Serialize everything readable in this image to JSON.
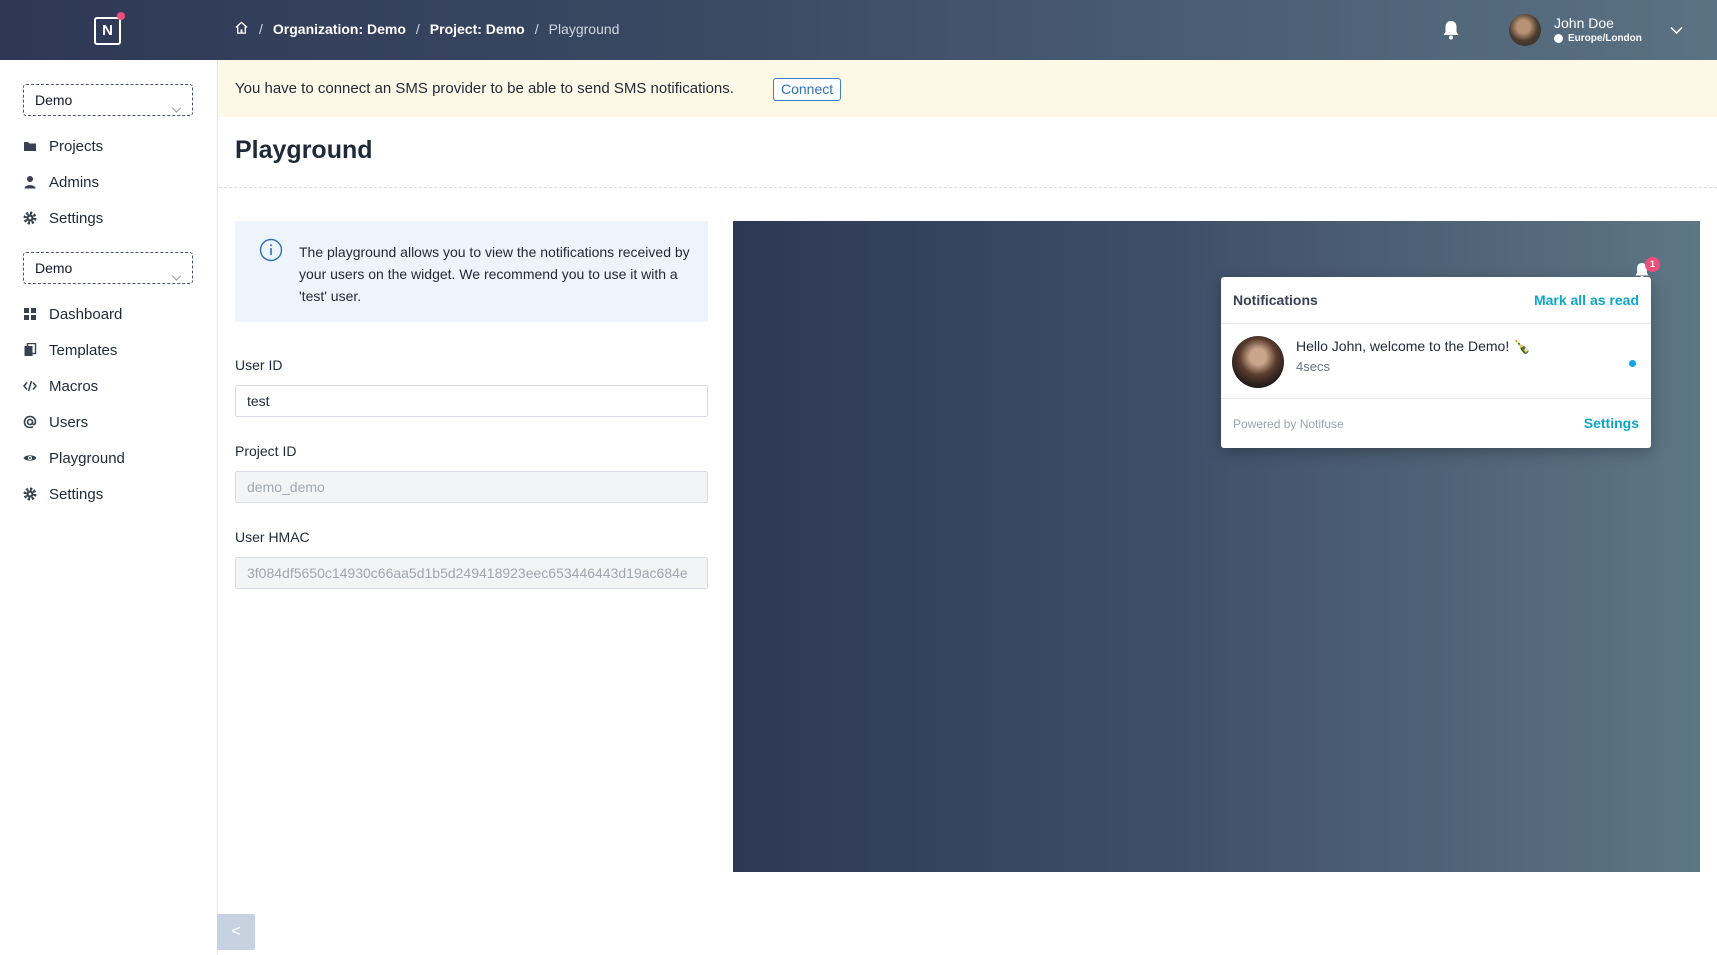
{
  "header": {
    "logo_letter": "N",
    "breadcrumb": {
      "organization": "Organization: Demo",
      "project": "Project: Demo",
      "current": "Playground",
      "separator": "/"
    },
    "user": {
      "name": "John Doe",
      "timezone": "Europe/London"
    }
  },
  "sidebar": {
    "org_selector": "Demo",
    "org_items": [
      {
        "label": "Projects",
        "icon": "folder-icon"
      },
      {
        "label": "Admins",
        "icon": "user-icon"
      },
      {
        "label": "Settings",
        "icon": "gear-icon"
      }
    ],
    "project_selector": "Demo",
    "project_items": [
      {
        "label": "Dashboard",
        "icon": "dashboard-icon"
      },
      {
        "label": "Templates",
        "icon": "templates-icon"
      },
      {
        "label": "Macros",
        "icon": "code-icon"
      },
      {
        "label": "Users",
        "icon": "at-icon"
      },
      {
        "label": "Playground",
        "icon": "eye-icon"
      },
      {
        "label": "Settings",
        "icon": "gear-icon"
      }
    ],
    "collapse_label": "<"
  },
  "alert": {
    "text": "You have to connect an SMS provider to be able to send SMS notifications.",
    "button": "Connect"
  },
  "main": {
    "title": "Playground",
    "info": "The playground allows you to view the notifications received by your users on the widget. We recommend you to use it with a 'test' user.",
    "fields": {
      "user_id_label": "User ID",
      "user_id_value": "test",
      "project_id_label": "Project ID",
      "project_id_value": "demo_demo",
      "hmac_label": "User HMAC",
      "hmac_value": "3f084df5650c14930c66aa5d1b5d249418923eec653446443d19ac684e"
    }
  },
  "widget": {
    "badge_count": "1",
    "title": "Notifications",
    "mark_all": "Mark all as read",
    "message": "Hello John, welcome to the Demo! 🍾",
    "time": "4secs",
    "powered_by": "Powered by Notifuse",
    "settings": "Settings"
  },
  "colors": {
    "accent": "#0ea5c6",
    "badge": "#ef4e7b",
    "header_start": "#2e3856",
    "header_end": "#5a7283"
  }
}
